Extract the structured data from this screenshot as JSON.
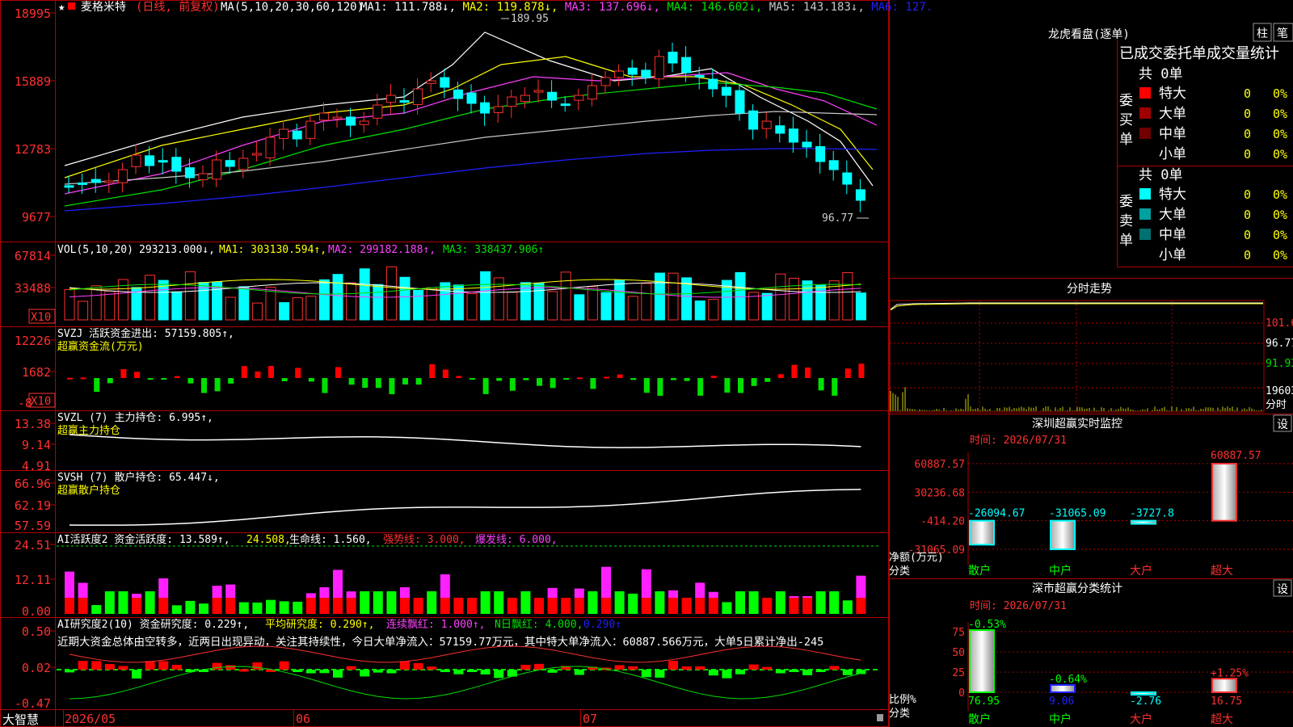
{
  "app": {
    "brand": "大智慧"
  },
  "header": {
    "star": "★",
    "stock_name": "麦格米特",
    "period": "(日线, 前复权)",
    "ma_params": "MA(5,10,20,30,60,120)",
    "items": [
      {
        "label": "MA1: 111.788↓,",
        "color": "#ffffff"
      },
      {
        "label": "MA2: 119.878↓,",
        "color": "#ffff00"
      },
      {
        "label": "MA3: 137.696↓,",
        "color": "#ff40ff"
      },
      {
        "label": "MA4: 146.602↓,",
        "color": "#00e000"
      },
      {
        "label": "MA5: 143.183↓,",
        "color": "#c8c8c8"
      },
      {
        "label": "MA6: 127.",
        "color": "#2020ff"
      }
    ]
  },
  "price_axis": [
    "18995",
    "15889",
    "12783",
    "9677"
  ],
  "annotations": {
    "high": "189.95",
    "low": "96.77"
  },
  "panels": {
    "vol": {
      "label": "VOL(5,10,20)",
      "value": "293213.000↓,",
      "ma1": "MA1: 303130.594↑,",
      "ma2": "MA2: 299182.188↑,",
      "ma3": "MA3: 338437.906↑",
      "axis": [
        "67814",
        "33488"
      ],
      "unit": "X10"
    },
    "svzj": {
      "label": "SVZJ  活跃资金进出: 57159.805↑,",
      "sub": "超赢资金流(万元)",
      "axis": [
        "12226",
        "1682",
        "-8"
      ],
      "unit": "X10"
    },
    "svzl": {
      "label": "SVZL (7) 主力持仓: 6.995↑,",
      "sub": "超赢主力持仓",
      "axis": [
        "13.38",
        "9.14",
        "4.91"
      ]
    },
    "svsh": {
      "label": "SVSH (7) 散户持仓: 65.447↓,",
      "sub": "超赢散户持仓",
      "axis": [
        "66.96",
        "62.19",
        "57.59"
      ]
    },
    "ai_active": {
      "label": "AI活跃度2 资金活跃度: 13.589↑,",
      "v2": "24.508,",
      "v3": "生命线: 1.560,",
      "v4": "强势线: 3.000,",
      "v5": "爆发线: 6.000,",
      "axis": [
        "24.51",
        "12.11",
        "0.00"
      ]
    },
    "ai_research": {
      "label": "AI研究度2(10) 资金研究度: 0.229↑,",
      "v2": "平均研究度: 0.290↑,",
      "v3": "连续飘红: 1.000↑,",
      "v4": "N日飘红: 4.000,",
      "v5": "0.290↑",
      "comment": "近期大资金总体由空转多，近两日出现异动，关注其持续性，今日大单净流入：57159.77万元，其中特大单净流入：60887.566万元，大单5日累计净出-245",
      "axis": [
        "0.50",
        "0.02",
        "-0.47"
      ]
    }
  },
  "x_axis": [
    "2026/05",
    "06",
    "07"
  ],
  "right": {
    "dragon": {
      "title": "龙虎看盘(逐单)",
      "btn1": "柱",
      "btn2": "笔",
      "subtitle": "已成交委托单成交量统计",
      "buy_label": "委买单",
      "sell_label": "委卖单",
      "buy_total": "共 0单",
      "sell_total": "共 0单",
      "buy_rows": [
        {
          "name": "特大",
          "count": "0",
          "pct": "0%",
          "color": "#ff0000"
        },
        {
          "name": "大单",
          "count": "0",
          "pct": "0%",
          "color": "#a00000"
        },
        {
          "name": "中单",
          "count": "0",
          "pct": "0%",
          "color": "#700000"
        },
        {
          "name": "小单",
          "count": "0",
          "pct": "0%",
          "color": "#000000"
        }
      ],
      "sell_rows": [
        {
          "name": "特大",
          "count": "0",
          "pct": "0%",
          "color": "#00ffff"
        },
        {
          "name": "大单",
          "count": "0",
          "pct": "0%",
          "color": "#00a0a0"
        },
        {
          "name": "中单",
          "count": "0",
          "pct": "0%",
          "color": "#007070"
        },
        {
          "name": "小单",
          "count": "0",
          "pct": "0%",
          "color": "#000000"
        }
      ]
    },
    "minute": {
      "title": "分时走势",
      "axis": [
        "101.6",
        "96.77",
        "91.93",
        "19603"
      ],
      "unit": "分时"
    },
    "monitor": {
      "title": "深圳超赢实时监控",
      "btn": "设",
      "time": "时间: 2026/07/31",
      "axis": [
        "60887.57",
        "30236.68",
        "-414.20",
        "-31065.09"
      ],
      "ylabel": "净额(万元)",
      "xlabel": "分类",
      "cats": [
        "散户",
        "中户",
        "大户",
        "超大"
      ],
      "values": [
        -26094.67,
        -31065.09,
        -3727.8,
        60887.57
      ],
      "labels": [
        "-26094.67",
        "-31065.09",
        "-3727.8",
        "60887.57"
      ]
    },
    "classify": {
      "title": "深市超赢分类统计",
      "btn": "设",
      "time": "时间: 2026/07/31",
      "axis": [
        "75",
        "50",
        "25",
        "0"
      ],
      "ylabel": "比例%",
      "xlabel": "分类",
      "cats": [
        "散户",
        "中户",
        "大户",
        "超大"
      ],
      "values": [
        76.95,
        9.06,
        -2.76,
        16.75
      ],
      "value_labels": [
        "76.95",
        "9.06",
        "-2.76",
        "16.75"
      ],
      "change_labels": [
        "-0.53%",
        "-0.64%",
        "",
        "+1.25%"
      ]
    }
  }
}
